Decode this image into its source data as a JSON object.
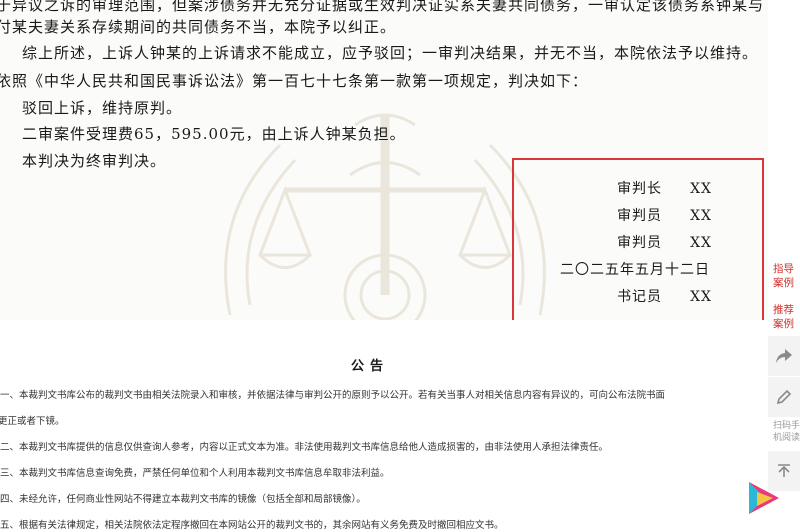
{
  "judgment": {
    "lines": [
      "于异议之诉的审理范围，但案涉债务并无充分证据或生效判决证实系夫妻共同债务，一审认定该债务系钟某与",
      "付某夫妻关系存续期间的共同债务不当，本院予以纠正。",
      "综上所述，上诉人钟某的上诉请求不能成立，应予驳回；一审判决结果，并无不当，本院依法予以维持。",
      "依照《中华人民共和国民事诉讼法》第一百七十七条第一款第一项规定，判决如下：",
      "驳回上诉，维持原判。",
      "二审案件受理费65，595.00元，由上诉人钟某负担。",
      "本判决为终审判决。"
    ]
  },
  "signature": {
    "chief_judge_role": "审判长",
    "chief_judge_name": "XX",
    "judge1_role": "审判员",
    "judge1_name": "XX",
    "judge2_role": "审判员",
    "judge2_name": "XX",
    "date": "二〇二五年五月十二日",
    "clerk_role": "书记员",
    "clerk_name": "XX"
  },
  "highlight_color": "#d9353b",
  "notice": {
    "title": "公告",
    "items": [
      "一、本裁判文书库公布的裁判文书由相关法院录入和审核，并依据法律与审判公开的原则予以公开。若有关当事人对相关信息内容有异议的，可向公布法院书面",
      "更正或者下镜。",
      "二、本裁判文书库提供的信息仅供查询人参考，内容以正式文本为准。非法使用裁判文书库信息给他人造成损害的，由非法使用人承担法律责任。",
      "三、本裁判文书库信息查询免费，严禁任何单位和个人利用本裁判文书库信息牟取非法利益。",
      "四、未经允许，任何商业性网站不得建立本裁判文书库的镜像（包括全部和局部镜像）。",
      "五、根据有关法律规定，相关法院依法定程序撤回在本网站公开的裁判文书的，其余网站有义务免费及时撤回相应文书。"
    ]
  },
  "sidebar": {
    "link1": "指导案例",
    "link2": "推荐案例",
    "share_icon": "share-icon",
    "edit_icon": "edit-icon",
    "scan_text": "扫码手机阅读",
    "top_icon": "back-to-top-icon"
  }
}
